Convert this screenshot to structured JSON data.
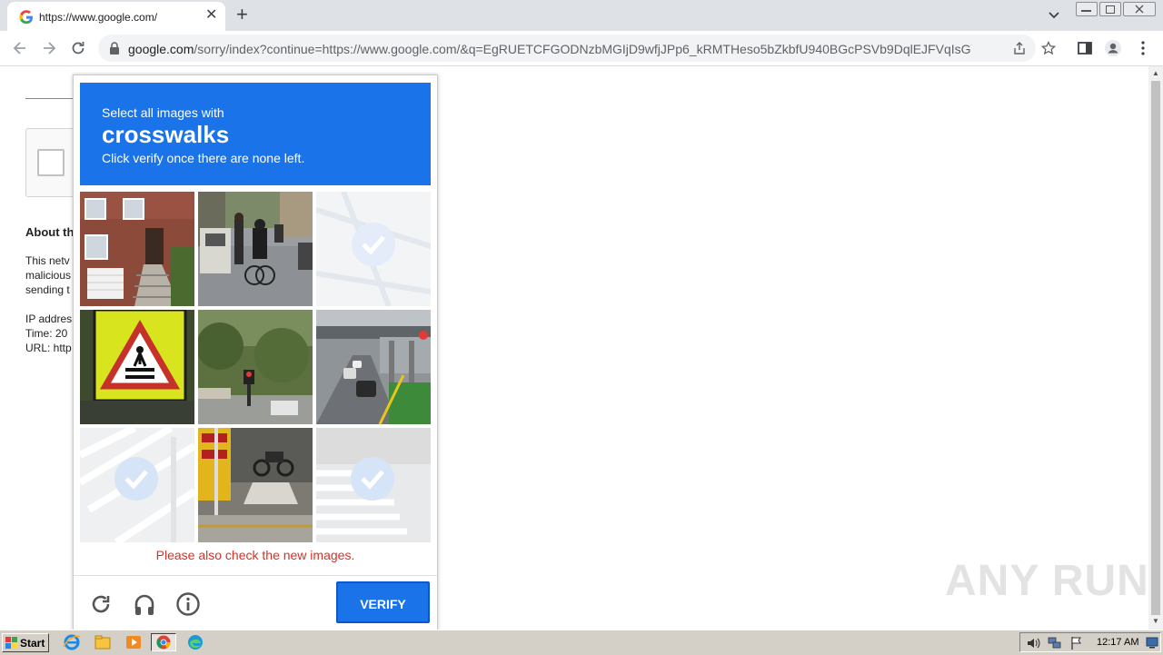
{
  "browser": {
    "tab_title": "https://www.google.com/",
    "tab_close": "✕",
    "new_tab": "+",
    "url_host": "google.com",
    "url_path": "/sorry/index?continue=https://www.google.com/&q=EgRUETCFGODNzbMGIjD9wfjJPp6_kRMTHeso5bZkbfU940BGcPSVb9DqlEJFVqIsGWrIeLui..."
  },
  "page": {
    "heading": "About th",
    "line1": "This netv",
    "line2": "malicious",
    "line3": "sending t",
    "ip": "IP addres",
    "time": "Time: 20",
    "url": "URL: http"
  },
  "captcha": {
    "select_text": "Select all images with",
    "target": "crosswalks",
    "instruction": "Click verify once there are none left.",
    "warning": "Please also check the new images.",
    "verify_label": "VERIFY",
    "tiles": [
      {
        "content": "brick-house",
        "selected": false
      },
      {
        "content": "street-cyclists",
        "selected": false
      },
      {
        "content": "map-faded",
        "selected": true
      },
      {
        "content": "crosswalk-sign",
        "selected": false
      },
      {
        "content": "street-traffic-light",
        "selected": false
      },
      {
        "content": "highway-overpass",
        "selected": false
      },
      {
        "content": "crosswalk-faded",
        "selected": true
      },
      {
        "content": "sidewalk-motorbike",
        "selected": false
      },
      {
        "content": "crosswalk-faded",
        "selected": true
      }
    ],
    "accent": "#1a73e8",
    "warning_color": "#d93025"
  },
  "watermark": "ANY RUN",
  "taskbar": {
    "start_label": "Start",
    "clock": "12:17 AM"
  }
}
